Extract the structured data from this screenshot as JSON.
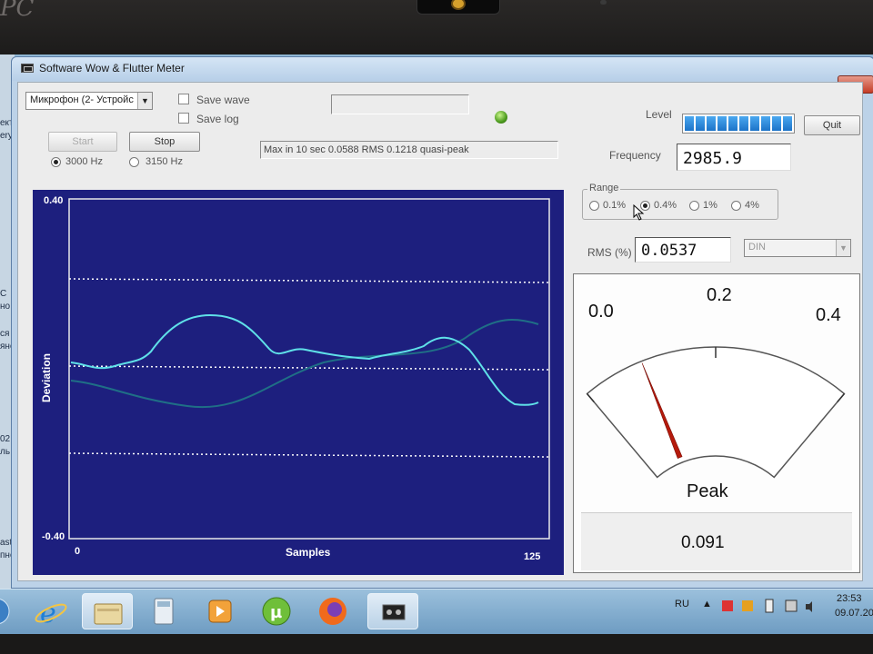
{
  "laptop": {
    "brand": "PC"
  },
  "window": {
    "title": "Software Wow & Flutter Meter",
    "close_symbol": "x"
  },
  "controls": {
    "device_select": "Микрофон (2- Устройс",
    "save_wave_label": "Save wave",
    "save_log_label": "Save log",
    "start_label": "Start",
    "stop_label": "Stop",
    "freq_options": [
      {
        "label": "3000 Hz",
        "selected": true
      },
      {
        "label": "3150 Hz",
        "selected": false
      }
    ],
    "status_text": "Max in 10 sec 0.0588 RMS 0.1218 quasi-peak",
    "level_label": "Level",
    "level_value": 1.0,
    "quit_label": "Quit",
    "frequency_label": "Frequency",
    "frequency_value": "2985.9",
    "range_label": "Range",
    "range_options": [
      {
        "label": "0.1%",
        "selected": false
      },
      {
        "label": "0.4%",
        "selected": true
      },
      {
        "label": "1%",
        "selected": false
      },
      {
        "label": "4%",
        "selected": false
      }
    ],
    "rms_label": "RMS (%)",
    "rms_value": "0.0537",
    "weighting_select": "DIN"
  },
  "graph": {
    "y_max_label": "0.40",
    "y_min_label": "-0.40",
    "y_title": "Deviation",
    "x_min_label": "0",
    "x_max_label": "125",
    "x_title": "Samples",
    "colors": {
      "background": "#1d1f7e",
      "primary_trace": "#5fe0e8",
      "secondary_trace": "#1f6f86",
      "grid": "#ffffff"
    }
  },
  "meter": {
    "scale_labels": [
      "0.0",
      "0.2",
      "0.4"
    ],
    "mode_label": "Peak",
    "value": "0.091",
    "needle_value": 0.091,
    "scale_max": 0.4,
    "needle_color": "#b51a0c"
  },
  "taskbar": {
    "language": "RU",
    "time": "23:53",
    "date": "09.07.20",
    "apps": [
      "ie-icon",
      "file-explorer-icon",
      "calculator-icon",
      "media-player-icon",
      "utorrent-icon",
      "firefox-icon",
      "wow-flutter-icon"
    ]
  },
  "desktop": {
    "left_fragments": [
      "ект",
      "ery",
      "",
      "",
      "С",
      "но",
      "ся",
      "яно",
      "",
      "02",
      "ль",
      "",
      "аst",
      "пно"
    ]
  }
}
